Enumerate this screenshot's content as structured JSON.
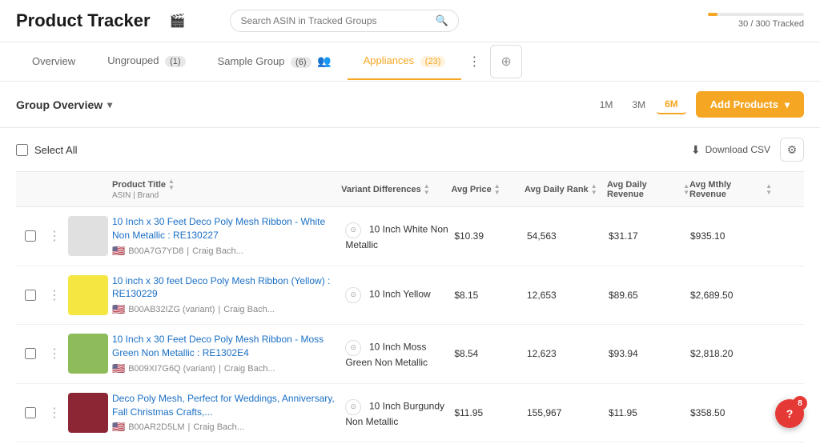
{
  "header": {
    "title": "Product Tracker",
    "icon": "🎬",
    "search_placeholder": "Search ASIN in Tracked Groups",
    "tracker_label": "30 / 300 Tracked",
    "tracker_fill_pct": 10
  },
  "tabs": [
    {
      "id": "overview",
      "label": "Overview",
      "badge": null,
      "active": false
    },
    {
      "id": "ungrouped",
      "label": "Ungrouped",
      "badge": "(1)",
      "active": false
    },
    {
      "id": "sample",
      "label": "Sample Group",
      "badge": "(6)",
      "has_icon": true,
      "active": false
    },
    {
      "id": "appliances",
      "label": "Appliances",
      "badge": "(23)",
      "active": true
    }
  ],
  "group_bar": {
    "title": "Group Overview",
    "time_filters": [
      "1M",
      "3M",
      "6M"
    ],
    "active_filter": "6M",
    "add_products_label": "Add Products"
  },
  "table": {
    "select_all_label": "Select All",
    "download_csv_label": "Download CSV",
    "columns": [
      {
        "id": "title",
        "label": "Product Title",
        "sub": "ASIN | Brand"
      },
      {
        "id": "variant",
        "label": "Variant Differences"
      },
      {
        "id": "price",
        "label": "Avg Price"
      },
      {
        "id": "rank",
        "label": "Avg Daily Rank"
      },
      {
        "id": "revenue",
        "label": "Avg Daily Revenue"
      },
      {
        "id": "mthly",
        "label": "Avg Mthly Revenue"
      }
    ],
    "rows": [
      {
        "id": "row1",
        "title": "10 Inch x 30 Feet Deco Poly Mesh Ribbon - White Non Metallic : RE130227",
        "asin": "B00A7G7YD8",
        "brand": "Craig Bach...",
        "variant": "10 Inch White Non Metallic",
        "price": "$10.39",
        "rank": "54,563",
        "revenue": "$31.17",
        "mthly": "$935.10",
        "img_color": "#e0e0e0"
      },
      {
        "id": "row2",
        "title": "10 inch x 30 feet Deco Poly Mesh Ribbon (Yellow) : RE130229",
        "asin": "B00AB32IZG (variant)",
        "brand": "Craig Bach...",
        "variant": "10 Inch Yellow",
        "price": "$8.15",
        "rank": "12,653",
        "revenue": "$89.65",
        "mthly": "$2,689.50",
        "img_color": "#f5e642"
      },
      {
        "id": "row3",
        "title": "10 Inch x 30 Feet Deco Poly Mesh Ribbon - Moss Green Non Metallic : RE1302E4",
        "asin": "B009XI7G6Q (variant)",
        "brand": "Craig Bach...",
        "variant": "10 Inch Moss Green Non Metallic",
        "price": "$8.54",
        "rank": "12,623",
        "revenue": "$93.94",
        "mthly": "$2,818.20",
        "img_color": "#8fbc5a"
      },
      {
        "id": "row4",
        "title": "Deco Poly Mesh, Perfect for Weddings, Anniversary, Fall Christmas Crafts,...",
        "asin": "B00AR2D5LM",
        "brand": "Craig Bach...",
        "variant": "10 Inch Burgundy Non Metallic",
        "price": "$11.95",
        "rank": "155,967",
        "revenue": "$11.95",
        "mthly": "$358.50",
        "img_color": "#8b2635"
      }
    ]
  },
  "help": {
    "count": "8",
    "label": "?"
  }
}
